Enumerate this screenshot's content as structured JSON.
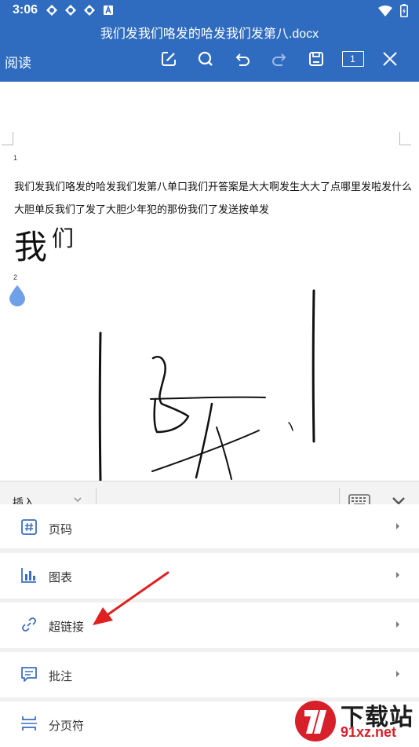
{
  "status_bar": {
    "time": "3:06"
  },
  "app_bar": {
    "title": "我们发我们咯发的哈发我们发第八.docx",
    "mode_label": "阅读",
    "page_count": "1",
    "icons": [
      "edit-icon",
      "search-icon",
      "undo-icon",
      "redo-icon",
      "save-icon",
      "page-count-icon",
      "close-icon"
    ]
  },
  "document": {
    "page1_number": "1",
    "line1": "我们发我们咯发的哈发我们发第八单口我们开答案是大大啊发生大大了点哪里发啦发什么",
    "line2": "大胆单反我们了发了大胆少年犯的那份我们了发送按单发",
    "big_text_a": "我",
    "big_text_b": "们",
    "page2_number": "2"
  },
  "insert_bar": {
    "label": "插入"
  },
  "menu": {
    "items": [
      {
        "label": "页码",
        "icon": "page-number-icon"
      },
      {
        "label": "图表",
        "icon": "chart-icon"
      },
      {
        "label": "超链接",
        "icon": "link-icon"
      },
      {
        "label": "批注",
        "icon": "comment-icon"
      },
      {
        "label": "分页符",
        "icon": "page-break-icon"
      }
    ]
  },
  "watermark": {
    "brand": "下载站",
    "url": "91xz.net"
  },
  "colors": {
    "primary": "#2f6cc0",
    "accent_icon": "#3b6fc2",
    "arrow": "#e02020"
  }
}
